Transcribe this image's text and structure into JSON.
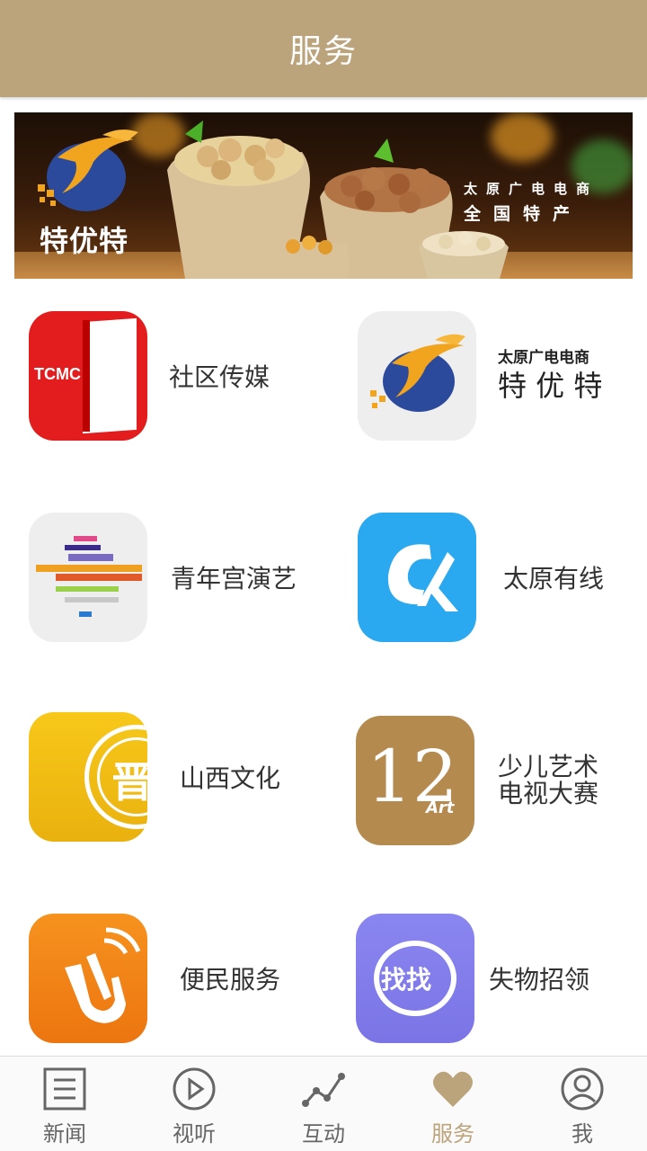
{
  "header": {
    "title": "服务"
  },
  "banner": {
    "logo_text": "特优特",
    "line1": "太原广电电商",
    "line2": "全国特产"
  },
  "services": [
    {
      "label": "社区传媒",
      "icon": "tcmc-icon",
      "icon_text": "TCMC"
    },
    {
      "label_small": "太原广电电商",
      "label_big": "特 优 特",
      "icon": "teyoute-icon"
    },
    {
      "label": "青年宫演艺",
      "icon": "youth-palace-icon"
    },
    {
      "label": "太原有线",
      "icon": "taiyuan-cable-icon"
    },
    {
      "label": "山西文化",
      "icon": "shanxi-culture-icon",
      "icon_text": "晋"
    },
    {
      "label_line1": "少儿艺术",
      "label_line2": "电视大赛",
      "icon": "kids-art-icon",
      "icon_text": "12",
      "icon_sub": "Art"
    },
    {
      "label": "便民服务",
      "icon": "convenience-icon"
    },
    {
      "label": "失物招领",
      "icon": "lost-found-icon",
      "icon_text": "找找"
    }
  ],
  "tabs": [
    {
      "label": "新闻",
      "icon": "news-icon"
    },
    {
      "label": "视听",
      "icon": "play-icon"
    },
    {
      "label": "互动",
      "icon": "interact-icon"
    },
    {
      "label": "服务",
      "icon": "heart-icon",
      "active": true
    },
    {
      "label": "我",
      "icon": "user-icon"
    }
  ],
  "colors": {
    "accent": "#bba47c",
    "text": "#333333"
  }
}
